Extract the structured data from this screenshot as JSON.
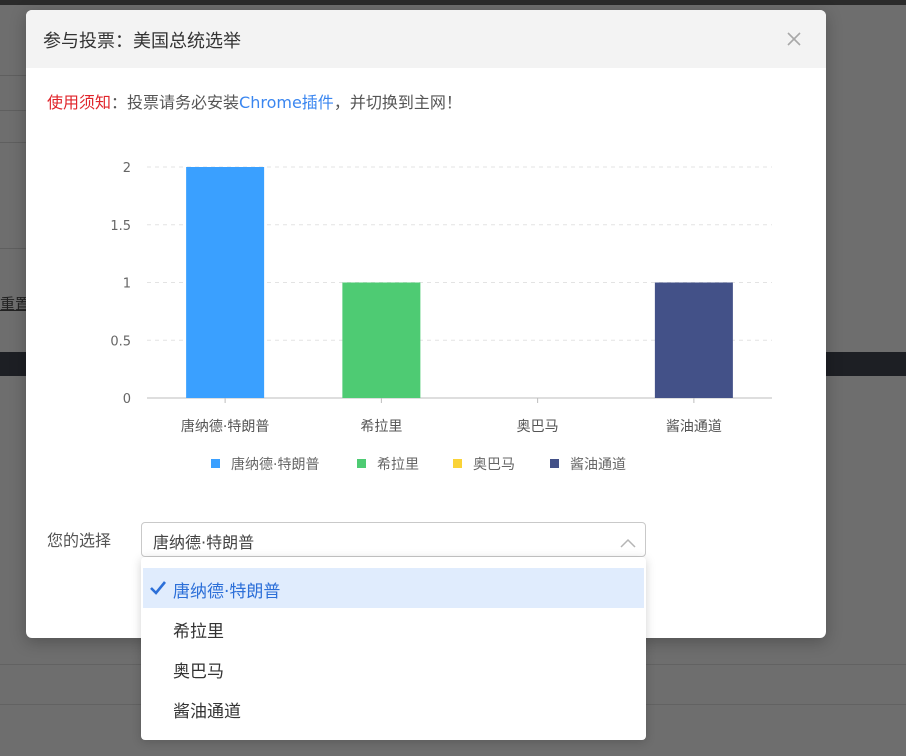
{
  "background": {
    "reset_label": "重置"
  },
  "modal": {
    "title": "参与投票：美国总统选举",
    "close_icon": "close-icon"
  },
  "notice": {
    "prefix": "使用须知",
    "colon": "：",
    "text1": "投票请务必安装",
    "link": "Chrome插件",
    "text2": "，并切换到主网！"
  },
  "chart_data": {
    "type": "bar",
    "categories": [
      "唐纳德·特朗普",
      "希拉里",
      "奥巴马",
      "酱油通道"
    ],
    "values": [
      2,
      1,
      0,
      1
    ],
    "colors": [
      "#3aa0ff",
      "#4ecb73",
      "#fad337",
      "#435188"
    ],
    "legend": [
      "唐纳德·特朗普",
      "希拉里",
      "奥巴马",
      "酱油通道"
    ],
    "legend_position": "bottom",
    "y_ticks": [
      "0",
      "0.5",
      "1",
      "1.5",
      "2"
    ],
    "ylim": [
      0,
      2
    ],
    "grid": true
  },
  "form": {
    "label": "您的选择",
    "selected_value": "唐纳德·特朗普",
    "options": [
      {
        "label": "唐纳德·特朗普",
        "selected": true
      },
      {
        "label": "希拉里",
        "selected": false
      },
      {
        "label": "奥巴马",
        "selected": false
      },
      {
        "label": "酱油通道",
        "selected": false
      }
    ]
  }
}
